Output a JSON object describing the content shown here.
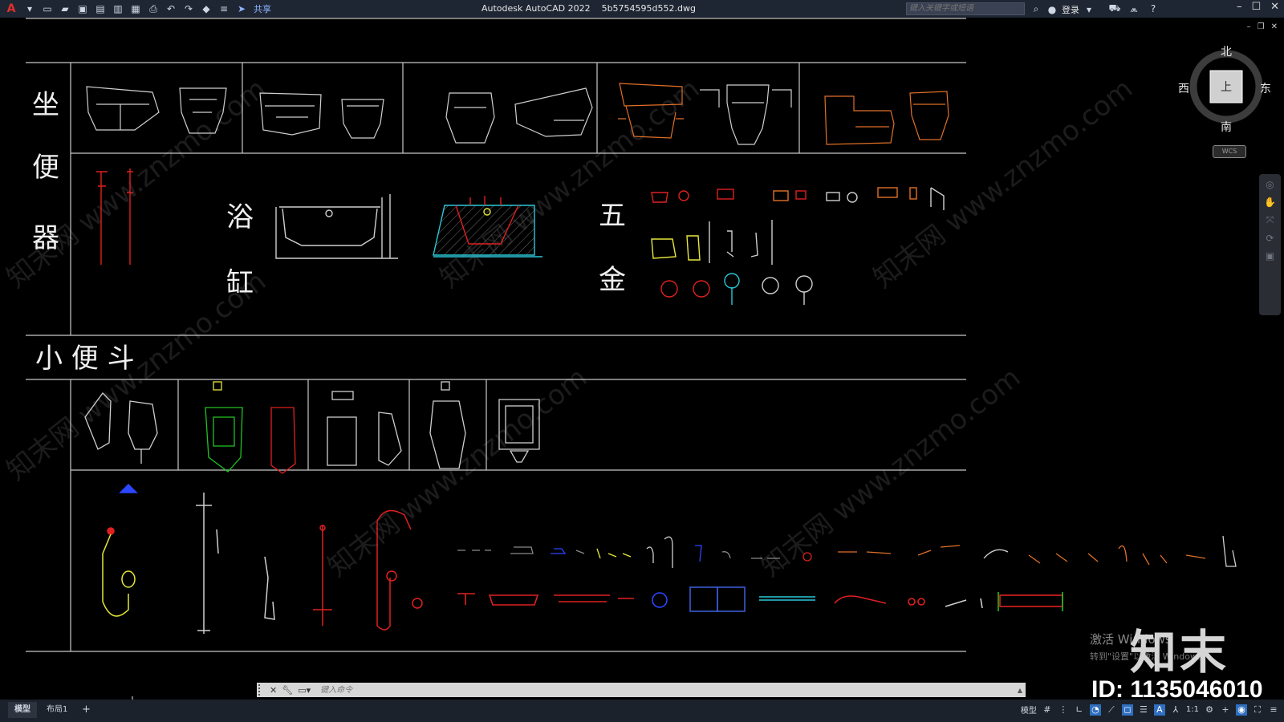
{
  "titlebar": {
    "app_logo": "A",
    "share_label": "共享",
    "title": "Autodesk AutoCAD 2022    5b5754595d552.dwg",
    "search_placeholder": "键入关键字或短语",
    "login_label": "登录"
  },
  "colors": {
    "background": "#000000",
    "titlebar": "#1f2633",
    "grid_line": "#c8c8c8",
    "red": "#e02020",
    "yellow": "#e8e83a",
    "green": "#22c022",
    "orange": "#e07028",
    "cyan": "#2ac8d8",
    "blue": "#2b46ff",
    "gray": "#c0c0c0"
  },
  "drawing": {
    "labels": {
      "toilet": [
        "坐",
        "便",
        "器"
      ],
      "bathtub": [
        "浴",
        "缸"
      ],
      "hardware": [
        "五",
        "金"
      ],
      "urinal": "小 便 斗"
    },
    "watermark": "知末网 www.znzmo.com"
  },
  "viewcube": {
    "north": "北",
    "south": "南",
    "west": "西",
    "east": "东",
    "face": "上",
    "wcs": "WCS"
  },
  "commandline": {
    "placeholder": "键入命令"
  },
  "statusbar": {
    "tabs": [
      "模型",
      "布局1",
      "+"
    ],
    "model_label": "模型",
    "scale": "1:1"
  },
  "overlay": {
    "activate_windows": "激活 Windows",
    "activate_sub": "转到\"设置\"以激活 Windows。",
    "brand": "知末",
    "id_text": "ID: 1135046010"
  }
}
